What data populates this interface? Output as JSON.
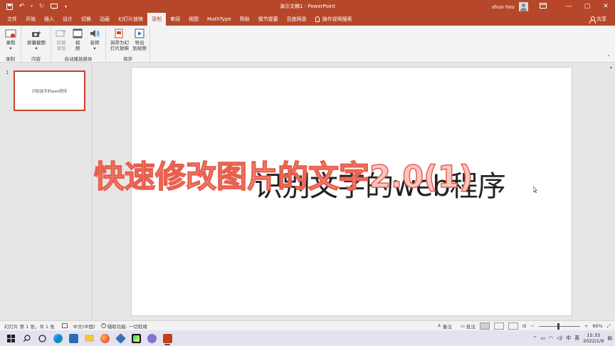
{
  "titlebar": {
    "doc_title": "演示文稿1  -  PowerPoint",
    "user_name": "shuo hou",
    "qat_redo_sep": "⁝",
    "window_controls": [
      "—",
      "▢",
      "✕"
    ]
  },
  "tabs": [
    "文件",
    "开始",
    "插入",
    "设计",
    "切换",
    "动画",
    "幻灯片放映",
    "录制",
    "审阅",
    "视图",
    "MathType",
    "帮助",
    "慎节提要",
    "百度网盘"
  ],
  "active_tab": "录制",
  "tell_me": "操作说明搜索",
  "share": "共享",
  "ribbon": {
    "groups": [
      {
        "label": "录制",
        "buttons": [
          {
            "label": "录制"
          }
        ]
      },
      {
        "label": "内容",
        "buttons": [
          {
            "label": "屏幕截图"
          }
        ]
      },
      {
        "label": "自动播放媒体",
        "buttons": [
          {
            "label": "屏幕录制"
          },
          {
            "label": "视频"
          },
          {
            "label": "音频"
          }
        ]
      },
      {
        "label": "保存",
        "buttons": [
          {
            "label": "另存为幻灯片放映"
          },
          {
            "label": "导出到视频"
          }
        ]
      }
    ],
    "button_lines": {
      "record": [
        "录制",
        "▾"
      ],
      "screenshot": [
        "屏幕截图",
        "▾"
      ],
      "screen_record": [
        "屏幕",
        "录制"
      ],
      "video": [
        "视",
        "频"
      ],
      "audio": [
        "音频",
        "▾"
      ],
      "save_as_show": [
        "另存为幻",
        "灯片放映"
      ],
      "export_video": [
        "导出",
        "到视频"
      ]
    }
  },
  "thumbnails": [
    {
      "number": "1",
      "text": "识别选字的web程序"
    }
  ],
  "slide": {
    "main_text": "识别文字的web程序",
    "overlay_title": "快速修改图片的文字2.0(1)"
  },
  "statusbar": {
    "slide_info": "幻灯片 第 1 张，共 1 张",
    "language": "中文(中国)",
    "accessibility": "辅助功能: 一切就绪",
    "notes": "备注",
    "comments": "批注",
    "zoom": "86%"
  },
  "taskbar": {
    "time": "15:33",
    "date": "2022/1/9",
    "ime": "中",
    "ime_mode": "英"
  },
  "colors": {
    "accent": "#b7472a",
    "overlay_fill": "#f9c6c2",
    "overlay_stroke": "#e8604e"
  }
}
